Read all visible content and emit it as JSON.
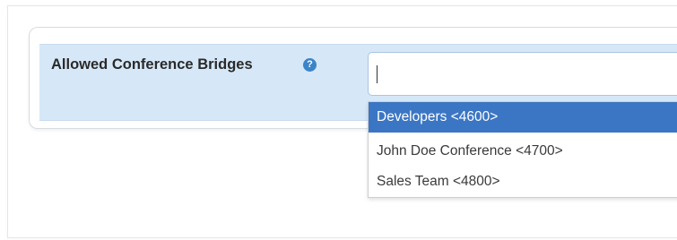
{
  "field": {
    "label": "Allowed Conference Bridges",
    "help_icon_glyph": "?",
    "input_value": ""
  },
  "dropdown": {
    "options": [
      {
        "label": "Developers <4600>",
        "selected": true
      },
      {
        "label": "John Doe Conference <4700>",
        "selected": false
      },
      {
        "label": "Sales Team <4800>",
        "selected": false
      }
    ]
  },
  "colors": {
    "row_background": "#d6e8f8",
    "selected_option": "#3b76c4",
    "help_icon": "#3c84c8"
  }
}
